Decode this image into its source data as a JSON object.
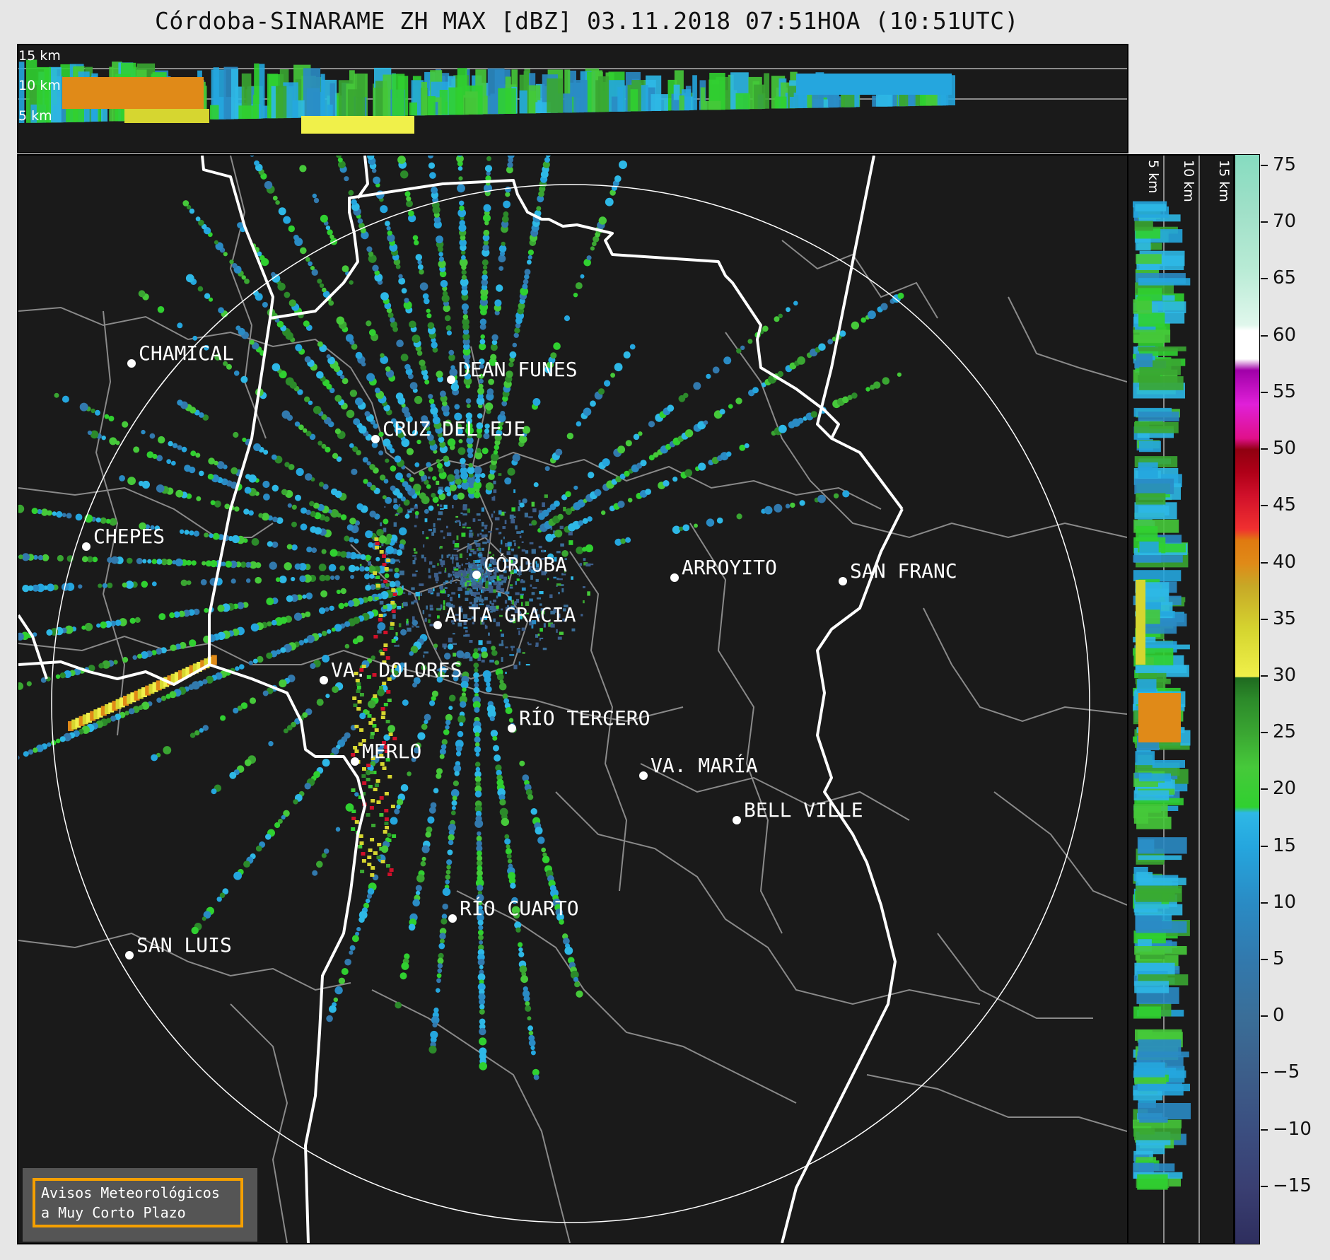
{
  "title": "Córdoba-SINARAME ZH MAX [dBZ] 03.11.2018 07:51HOA (10:51UTC)",
  "top_panel": {
    "altitude_labels": [
      "15 km",
      "10 km",
      "5 km"
    ]
  },
  "right_panel": {
    "altitude_labels": [
      "5 km",
      "10 km",
      "15 km"
    ]
  },
  "colorbar": {
    "ticks": [
      "75",
      "70",
      "65",
      "60",
      "55",
      "50",
      "45",
      "40",
      "35",
      "30",
      "25",
      "20",
      "15",
      "10",
      "5",
      "0",
      "−5",
      "−10",
      "−15"
    ],
    "tick_values": [
      75,
      70,
      65,
      60,
      55,
      50,
      45,
      40,
      35,
      30,
      25,
      20,
      15,
      10,
      5,
      0,
      -5,
      -10,
      -15
    ],
    "range": [
      -20,
      76
    ]
  },
  "cities": [
    {
      "name": "CHAMICAL"
    },
    {
      "name": "DEAN FUNES"
    },
    {
      "name": "CRUZ DEL EJE"
    },
    {
      "name": "CHEPES"
    },
    {
      "name": "CÓRDOBA"
    },
    {
      "name": "ARROYITO"
    },
    {
      "name": "SAN FRANC"
    },
    {
      "name": "ALTA GRACIA"
    },
    {
      "name": "VA. DOLORES"
    },
    {
      "name": "RÍO TERCERO"
    },
    {
      "name": "MERLO"
    },
    {
      "name": "VA. MARÍA"
    },
    {
      "name": "BELL VILLE"
    },
    {
      "name": "RÍO CUARTO"
    },
    {
      "name": "SAN LUIS"
    }
  ],
  "logo": {
    "line1": "Avisos Meteorológicos",
    "line2": "a Muy Corto Plazo"
  },
  "colors": {
    "background": "#1a1a1a",
    "border_lines": "#ffffff",
    "dept_lines": "#8a8a8a",
    "logo_border": "#f5a000"
  }
}
